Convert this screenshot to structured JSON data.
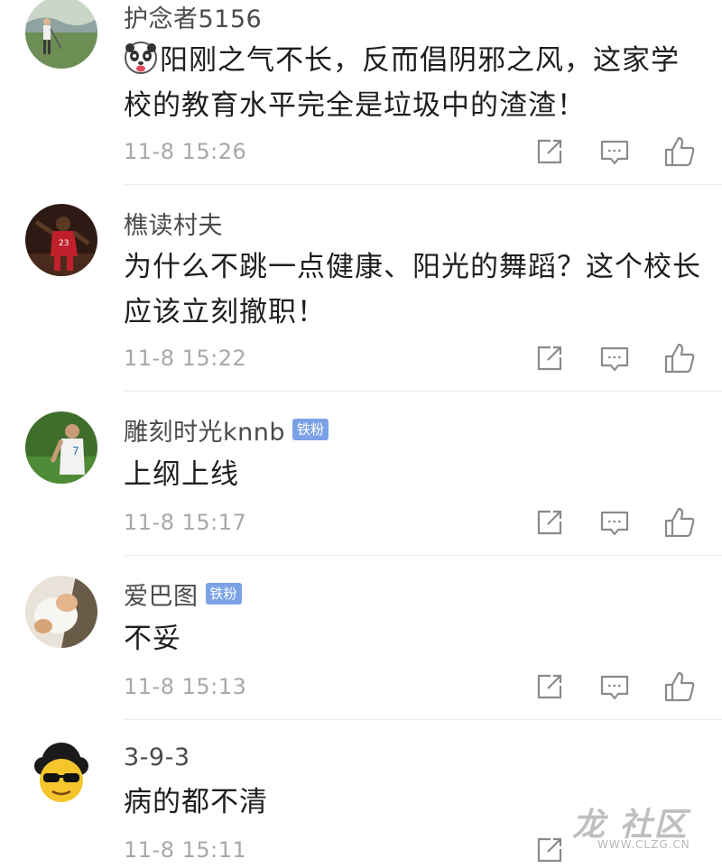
{
  "comments": [
    {
      "username": "护念者5156",
      "badge": "",
      "emoji": "panda-face-emoji",
      "text": "阳刚之气不长，反而倡阴邪之风，这家学校的教育水平完全是垃圾中的渣渣！",
      "time": "11-8 15:26",
      "avatar": "golfer-avatar"
    },
    {
      "username": "樵读村夫",
      "badge": "",
      "text": "为什么不跳一点健康、阳光的舞蹈？这个校长应该立刻撤职！",
      "time": "11-8 15:22",
      "avatar": "basketball-player-avatar"
    },
    {
      "username": "雕刻时光knnb",
      "badge": "铁粉",
      "text": "上纲上线",
      "time": "11-8 15:17",
      "avatar": "soccer-player-avatar"
    },
    {
      "username": "爱巴图",
      "badge": "铁粉",
      "text": "不妥",
      "time": "11-8 15:13",
      "avatar": "cat-avatar"
    },
    {
      "username": "3-9-3",
      "badge": "",
      "text": "病的都不清",
      "time": "11-8 15:11",
      "avatar": "sunglasses-emoji-avatar"
    }
  ],
  "actions": {
    "share_icon": "share-icon",
    "reply_icon": "comment-reply-icon",
    "like_icon": "thumbs-up-icon"
  },
  "watermark": {
    "main": "龙 社区",
    "url": "WWW.CLZG.CN"
  },
  "colors": {
    "badge_bg": "#7ba2e6",
    "time": "#a8a8a8",
    "icon": "#8a8a8a",
    "divider": "#ececec"
  }
}
